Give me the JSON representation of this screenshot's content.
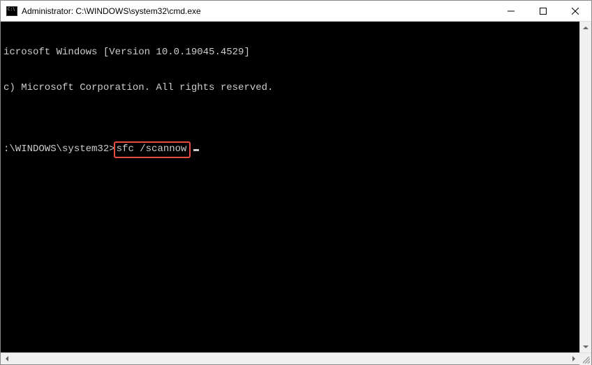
{
  "window": {
    "title": "Administrator: C:\\WINDOWS\\system32\\cmd.exe"
  },
  "terminal": {
    "line1": "icrosoft Windows [Version 10.0.19045.4529]",
    "line2": "c) Microsoft Corporation. All rights reserved.",
    "blank": "",
    "prompt": ":\\WINDOWS\\system32>",
    "command": "sfc /scannow"
  },
  "highlight": {
    "color": "#e74c3c"
  }
}
